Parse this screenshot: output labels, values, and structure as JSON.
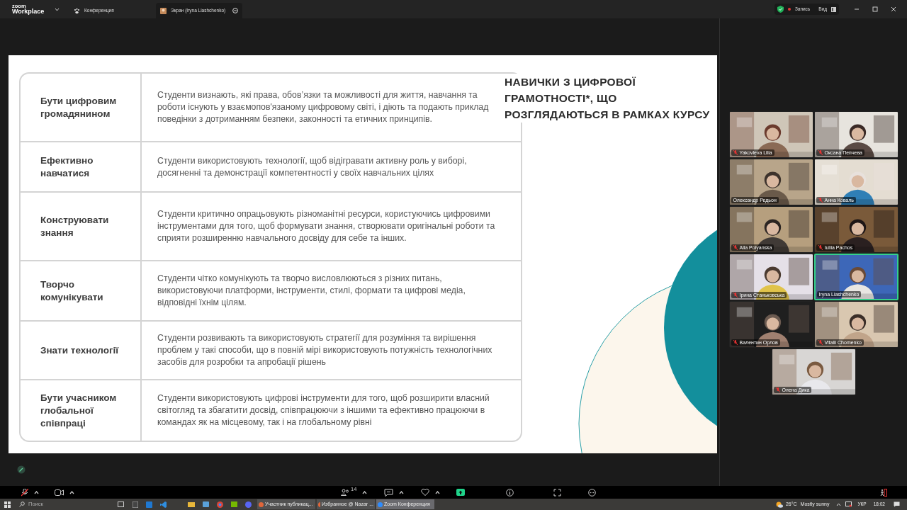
{
  "app_bar": {
    "logo_top": "zoom",
    "logo": "Workplace",
    "tabs": [
      {
        "label": "Конференция",
        "selected": false
      },
      {
        "label": "Экран (Iryna Liashchenko)",
        "selected": true
      }
    ],
    "recording": "Запись",
    "view": "Вид"
  },
  "slide": {
    "title": "НАВИЧКИ З ЦИФРОВОЇ ГРАМОТНОСТІ*,  ЩО РОЗГЛЯДАЮТЬСЯ В РАМКАХ КУРСУ",
    "rows": [
      {
        "skill": "Бути цифровим громадянином",
        "description": "Студенти визнають, які права, обовʼязки та можливості для життя, навчання та роботи існують у взаємопов'язаному цифровому світі, і діють та подають приклад поведінки з дотриманням безпеки, законності та етичних принципів."
      },
      {
        "skill": "Ефективно навчатися",
        "description": "Студенти використовують технології, щоб відігравати активну роль у виборі, досягненні та демонстрації компетентності у своїх навчальних цілях"
      },
      {
        "skill": "Конструювати знання",
        "description": "Студенти критично опрацьовують різноманітні ресурси, користуючись цифровими інструментами для того, щоб формувати знання, створювати оригінальні роботи та сприяти розширенню навчального досвіду для себе та інших."
      },
      {
        "skill": "Творчо комунікувати",
        "description": "Студенти чітко комунікують та творчо висловлюються з різних питань, використовуючи платформи, інструменти, стилі, формати та цифрові медіа, відповідні їхнім цілям."
      },
      {
        "skill": "Знати технології",
        "description": "Студенти розвивають та використовують стратегії для розуміння та вирішення проблем у такі способи, що в повній мірі використовують потужність технологічних засобів для розробки та апробації рішень"
      },
      {
        "skill": "Бути учасником глобальної співпраці",
        "description": "Студенти використовують цифрові інструменти для того, щоб розширити власний світогляд та збагатити досвід, співпрацюючи з іншими та ефективно працюючи в командах як на місцевому, так і на глобальному рівні"
      }
    ]
  },
  "participants": [
    {
      "name": "Yakovleva Lilia",
      "muted": true,
      "speaking": false
    },
    {
      "name": "Оксана Пепчева",
      "muted": true,
      "speaking": false
    },
    {
      "name": "Олександр Редьон",
      "muted": false,
      "speaking": false
    },
    {
      "name": "Анна Коваль",
      "muted": true,
      "speaking": false
    },
    {
      "name": "Alla Polyanska",
      "muted": true,
      "speaking": false
    },
    {
      "name": "Iuliia Pachos",
      "muted": true,
      "speaking": false
    },
    {
      "name": "Ірина Станьковська",
      "muted": true,
      "speaking": false
    },
    {
      "name": "Iryna Liashchenko",
      "muted": false,
      "speaking": true
    },
    {
      "name": "Валентин Орлов",
      "muted": true,
      "speaking": false
    },
    {
      "name": "Vitalii Chomenko",
      "muted": true,
      "speaking": false
    },
    {
      "name": "Олена Дика",
      "muted": true,
      "speaking": false
    }
  ],
  "toolbar": {
    "participants_count": "14"
  },
  "taskbar": {
    "search_placeholder": "Поиск",
    "windows": [
      {
        "label": "Участник публикац...",
        "selected": false
      },
      {
        "label": "Избранное @ Nazar ...",
        "selected": false
      },
      {
        "label": "Zoom Конференция",
        "selected": true
      }
    ],
    "temperature": "26°C",
    "weather": "Mostly sunny",
    "language": "УКР",
    "time": "18:02"
  }
}
